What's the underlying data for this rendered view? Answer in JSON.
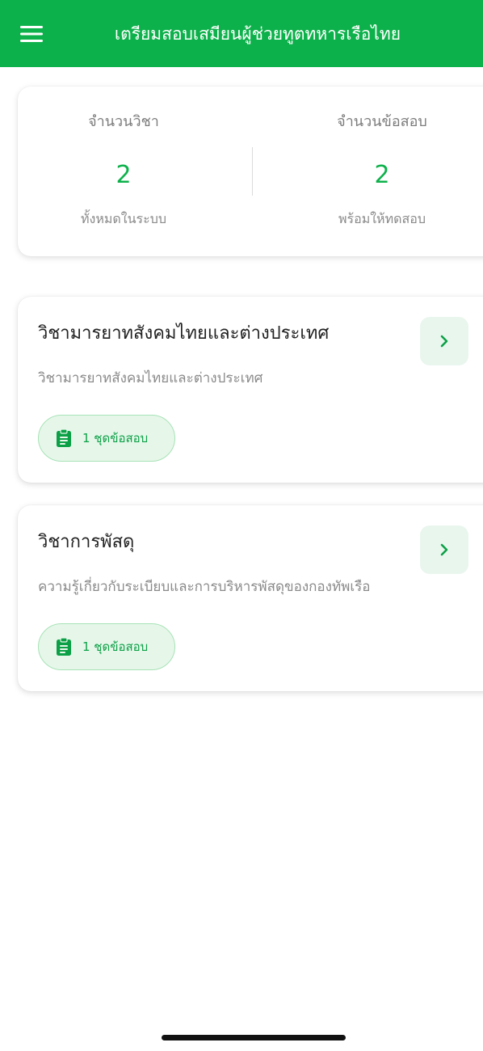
{
  "appbar": {
    "title": "เตรียมสอบเสมียนผู้ช่วยทูตทหารเรือไทย",
    "menu_icon": "hamburger-menu-icon"
  },
  "stats": {
    "subjects": {
      "label": "จำนวนวิชา",
      "value": "2",
      "sub": "ทั้งหมดในระบบ"
    },
    "exams": {
      "label": "จำนวนข้อสอบ",
      "value": "2",
      "sub": "พร้อมให้ทดสอบ"
    }
  },
  "subjects": [
    {
      "title": "วิชามารยาทสังคมไทยและต่างประเทศ",
      "description": "วิชามารยาทสังคมไทยและต่างประเทศ",
      "badge": "1 ชุดข้อสอบ"
    },
    {
      "title": "วิชาการพัสดุ",
      "description": "ความรู้เกี่ยวกับระเบียบและการบริหารพัสดุของกองทัพเรือ",
      "badge": "1 ชุดข้อสอบ"
    }
  ],
  "colors": {
    "primary": "#0db14b",
    "badge_bg": "#e6f7ea",
    "arrow_bg": "#e9f6ee"
  }
}
